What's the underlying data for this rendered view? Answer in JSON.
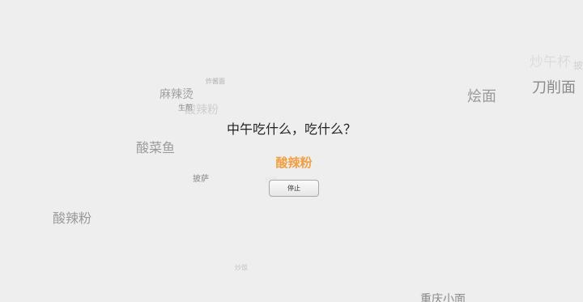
{
  "question": "中午吃什么，吃什么？",
  "result": "酸辣粉",
  "stop_label": "停止",
  "floating_words": [
    {
      "text": "炒午杯",
      "color": "#dcdcdc"
    },
    {
      "text": "披",
      "color": "#d2d2d2"
    },
    {
      "text": "刀削面",
      "color": "#8a8a8a"
    },
    {
      "text": "烩面",
      "color": "#9a9a9a"
    },
    {
      "text": "炸酱面",
      "color": "#b0b0b0"
    },
    {
      "text": "麻辣烫",
      "color": "#a0a0a0"
    },
    {
      "text": "酸辣粉",
      "color": "#cfcfcf"
    },
    {
      "text": "生煎",
      "color": "#8e8e8e"
    },
    {
      "text": "酸菜鱼",
      "color": "#9a9a9a"
    },
    {
      "text": "披萨",
      "color": "#8a8a8a"
    },
    {
      "text": "炒面",
      "color": "#e2e2e2"
    },
    {
      "text": "酸辣粉",
      "color": "#9a9a9a"
    },
    {
      "text": "炒饭",
      "color": "#c4c4c4"
    },
    {
      "text": "重庆小面",
      "color": "#8a8a8a"
    }
  ]
}
